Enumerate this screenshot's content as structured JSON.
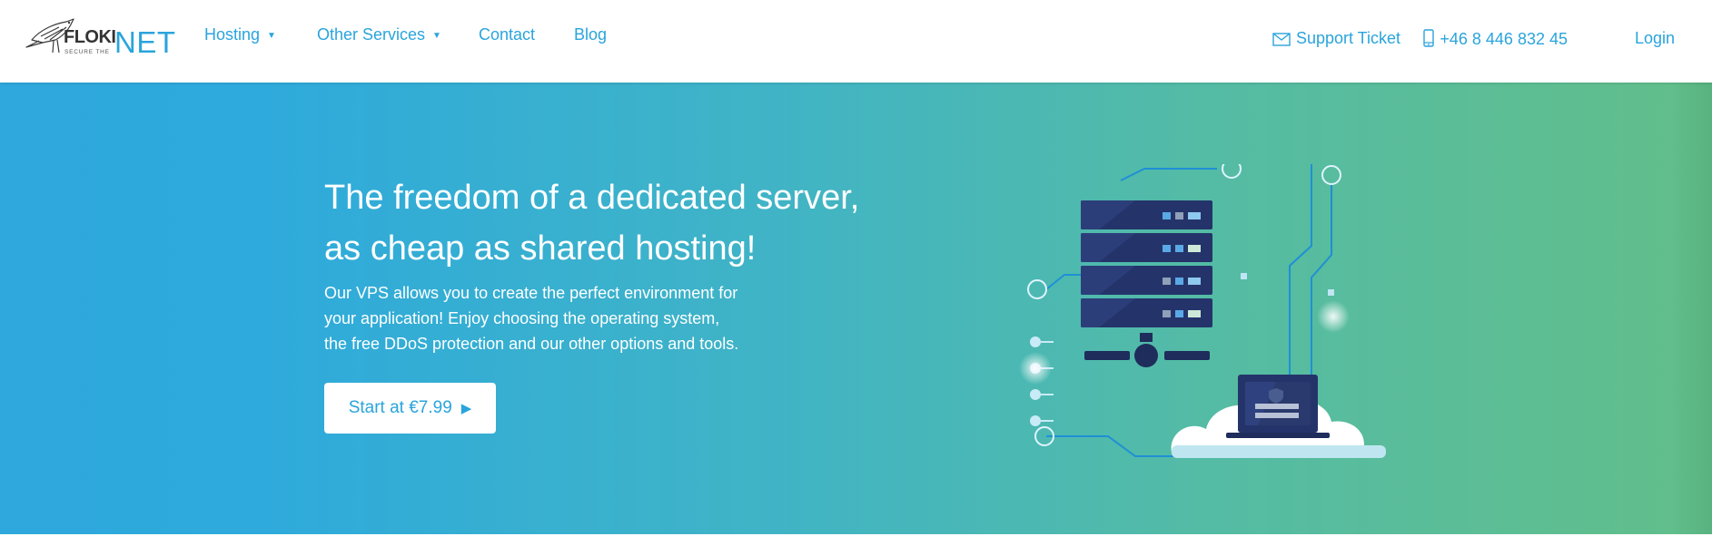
{
  "header": {
    "logo": {
      "brand_left": "FLOKI",
      "brand_right": "NET",
      "tagline": "SECURE THE"
    },
    "nav": [
      {
        "label": "Hosting",
        "has_dropdown": true
      },
      {
        "label": "Other Services",
        "has_dropdown": true
      },
      {
        "label": "Contact",
        "has_dropdown": false
      },
      {
        "label": "Blog",
        "has_dropdown": false
      }
    ],
    "right": {
      "support": {
        "label": "Support Ticket",
        "icon": "envelope-icon"
      },
      "phone": {
        "label": "+46 8 446 832 45",
        "icon": "mobile-phone-icon"
      },
      "login": {
        "label": "Login"
      }
    }
  },
  "hero": {
    "title_lines": [
      "The freedom of a dedicated server,",
      "as cheap as shared hosting!"
    ],
    "description_lines": [
      "Our VPS allows you to create the perfect environment for",
      "your application! Enjoy choosing the operating system,",
      "the free DDoS protection and our other options and tools."
    ],
    "cta": {
      "label": "Start at €7.99",
      "arrow": "▶"
    },
    "illustration": "server-cloud-illustration"
  },
  "colors": {
    "accent": "#2aa4dc",
    "gradient_start": "#2fa8dd",
    "gradient_end": "#62bf8a",
    "server_dark": "#1e2d5c",
    "server_light": "#2f4580"
  }
}
